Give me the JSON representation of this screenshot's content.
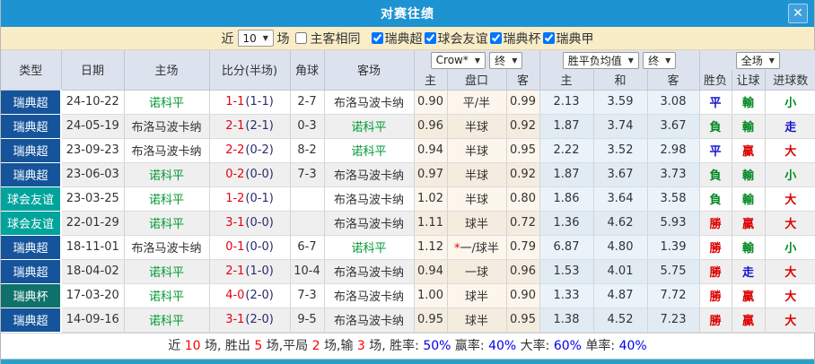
{
  "window": {
    "title": "对赛往绩",
    "close_icon": "✕"
  },
  "icons": {
    "dropdown_arrow": "▼"
  },
  "filter": {
    "near_label": "近",
    "games_count": "10",
    "games_label": "场",
    "same_venue": {
      "label": "主客相同",
      "checked": false
    },
    "leagues": [
      {
        "label": "瑞典超",
        "checked": true
      },
      {
        "label": "球会友谊",
        "checked": true
      },
      {
        "label": "瑞典杯",
        "checked": true
      },
      {
        "label": "瑞典甲",
        "checked": true
      }
    ]
  },
  "table": {
    "left_headers": [
      "类型",
      "日期",
      "主场",
      "比分(半场)",
      "角球",
      "客场"
    ],
    "dropdowns": {
      "odds_company": "Crow*",
      "odds_company_state": "终",
      "avg_label": "胜平负均值",
      "avg_state": "终",
      "scope": "全场"
    },
    "sub_headers": [
      "主",
      "盘口",
      "客",
      "主",
      "和",
      "客",
      "胜负",
      "让球",
      "进球数"
    ]
  },
  "league_colors": {
    "瑞典超": "#15549b",
    "球会友谊": "#00a49c",
    "瑞典杯": "#0e716a",
    "瑞典甲": "#15549b"
  },
  "team_colors": {
    "诺科平": "#009933",
    "布洛马波卡纳": "#333333"
  },
  "score_colors": {
    "fulltime": "#e60012",
    "halftime": "#2a2a6e"
  },
  "value_colors": {
    "勝": "#dd0000",
    "負": "#008822",
    "平": "#1414cc",
    "贏": "#dd0000",
    "輸": "#008822",
    "走": "#1414cc",
    "大": "#dd0000",
    "小": "#008822"
  },
  "rows": [
    {
      "league": "瑞典超",
      "date": "24-10-22",
      "home": "诺科平",
      "ft": "1-1",
      "ht": "(1-1)",
      "corners": "2-7",
      "away": "布洛马波卡纳",
      "odds_home": "0.90",
      "handicap": "平/半",
      "star": false,
      "odds_away": "0.99",
      "avg_home": "2.13",
      "avg_draw": "3.59",
      "avg_away": "3.08",
      "result": "平",
      "handicap_result": "輸",
      "goals": "小"
    },
    {
      "league": "瑞典超",
      "date": "24-05-19",
      "home": "布洛马波卡纳",
      "ft": "2-1",
      "ht": "(2-1)",
      "corners": "0-3",
      "away": "诺科平",
      "odds_home": "0.96",
      "handicap": "半球",
      "star": false,
      "odds_away": "0.92",
      "avg_home": "1.87",
      "avg_draw": "3.74",
      "avg_away": "3.67",
      "result": "負",
      "handicap_result": "輸",
      "goals": "走"
    },
    {
      "league": "瑞典超",
      "date": "23-09-23",
      "home": "布洛马波卡纳",
      "ft": "2-2",
      "ht": "(0-2)",
      "corners": "8-2",
      "away": "诺科平",
      "odds_home": "0.94",
      "handicap": "半球",
      "star": false,
      "odds_away": "0.95",
      "avg_home": "2.22",
      "avg_draw": "3.52",
      "avg_away": "2.98",
      "result": "平",
      "handicap_result": "贏",
      "goals": "大"
    },
    {
      "league": "瑞典超",
      "date": "23-06-03",
      "home": "诺科平",
      "ft": "0-2",
      "ht": "(0-0)",
      "corners": "7-3",
      "away": "布洛马波卡纳",
      "odds_home": "0.97",
      "handicap": "半球",
      "star": false,
      "odds_away": "0.92",
      "avg_home": "1.87",
      "avg_draw": "3.67",
      "avg_away": "3.73",
      "result": "負",
      "handicap_result": "輸",
      "goals": "小"
    },
    {
      "league": "球会友谊",
      "date": "23-03-25",
      "home": "诺科平",
      "ft": "1-2",
      "ht": "(0-1)",
      "corners": "",
      "away": "布洛马波卡纳",
      "odds_home": "1.02",
      "handicap": "半球",
      "star": false,
      "odds_away": "0.80",
      "avg_home": "1.86",
      "avg_draw": "3.64",
      "avg_away": "3.58",
      "result": "負",
      "handicap_result": "輸",
      "goals": "大"
    },
    {
      "league": "球会友谊",
      "date": "22-01-29",
      "home": "诺科平",
      "ft": "3-1",
      "ht": "(0-0)",
      "corners": "",
      "away": "布洛马波卡纳",
      "odds_home": "1.11",
      "handicap": "球半",
      "star": false,
      "odds_away": "0.72",
      "avg_home": "1.36",
      "avg_draw": "4.62",
      "avg_away": "5.93",
      "result": "勝",
      "handicap_result": "贏",
      "goals": "大"
    },
    {
      "league": "瑞典超",
      "date": "18-11-01",
      "home": "布洛马波卡纳",
      "ft": "0-1",
      "ht": "(0-0)",
      "corners": "6-7",
      "away": "诺科平",
      "odds_home": "1.12",
      "handicap": "一/球半",
      "star": true,
      "odds_away": "0.79",
      "avg_home": "6.87",
      "avg_draw": "4.80",
      "avg_away": "1.39",
      "result": "勝",
      "handicap_result": "輸",
      "goals": "小"
    },
    {
      "league": "瑞典超",
      "date": "18-04-02",
      "home": "诺科平",
      "ft": "2-1",
      "ht": "(1-0)",
      "corners": "10-4",
      "away": "布洛马波卡纳",
      "odds_home": "0.94",
      "handicap": "一球",
      "star": false,
      "odds_away": "0.96",
      "avg_home": "1.53",
      "avg_draw": "4.01",
      "avg_away": "5.75",
      "result": "勝",
      "handicap_result": "走",
      "goals": "大"
    },
    {
      "league": "瑞典杯",
      "date": "17-03-20",
      "home": "诺科平",
      "ft": "4-0",
      "ht": "(2-0)",
      "corners": "7-3",
      "away": "布洛马波卡纳",
      "odds_home": "1.00",
      "handicap": "球半",
      "star": false,
      "odds_away": "0.90",
      "avg_home": "1.33",
      "avg_draw": "4.87",
      "avg_away": "7.72",
      "result": "勝",
      "handicap_result": "贏",
      "goals": "大"
    },
    {
      "league": "瑞典超",
      "date": "14-09-16",
      "home": "诺科平",
      "ft": "3-1",
      "ht": "(2-0)",
      "corners": "9-5",
      "away": "布洛马波卡纳",
      "odds_home": "0.95",
      "handicap": "球半",
      "star": false,
      "odds_away": "0.95",
      "avg_home": "1.38",
      "avg_draw": "4.52",
      "avg_away": "7.23",
      "result": "勝",
      "handicap_result": "贏",
      "goals": "大"
    }
  ],
  "summary": {
    "colors": {
      "red": "#ff0000",
      "blue": "#0000ee"
    },
    "parts": [
      {
        "t": "近 "
      },
      {
        "t": "10",
        "c": "red"
      },
      {
        "t": " 场, 胜出 "
      },
      {
        "t": "5",
        "c": "red"
      },
      {
        "t": " 场,平局 "
      },
      {
        "t": "2",
        "c": "red"
      },
      {
        "t": " 场,输 "
      },
      {
        "t": "3",
        "c": "red"
      },
      {
        "t": " 场, 胜率: "
      },
      {
        "t": "50%",
        "c": "blue"
      },
      {
        "t": " 赢率: "
      },
      {
        "t": "40%",
        "c": "blue"
      },
      {
        "t": " 大率: "
      },
      {
        "t": "60%",
        "c": "blue"
      },
      {
        "t": " 单率: "
      },
      {
        "t": "40%",
        "c": "blue"
      }
    ]
  }
}
